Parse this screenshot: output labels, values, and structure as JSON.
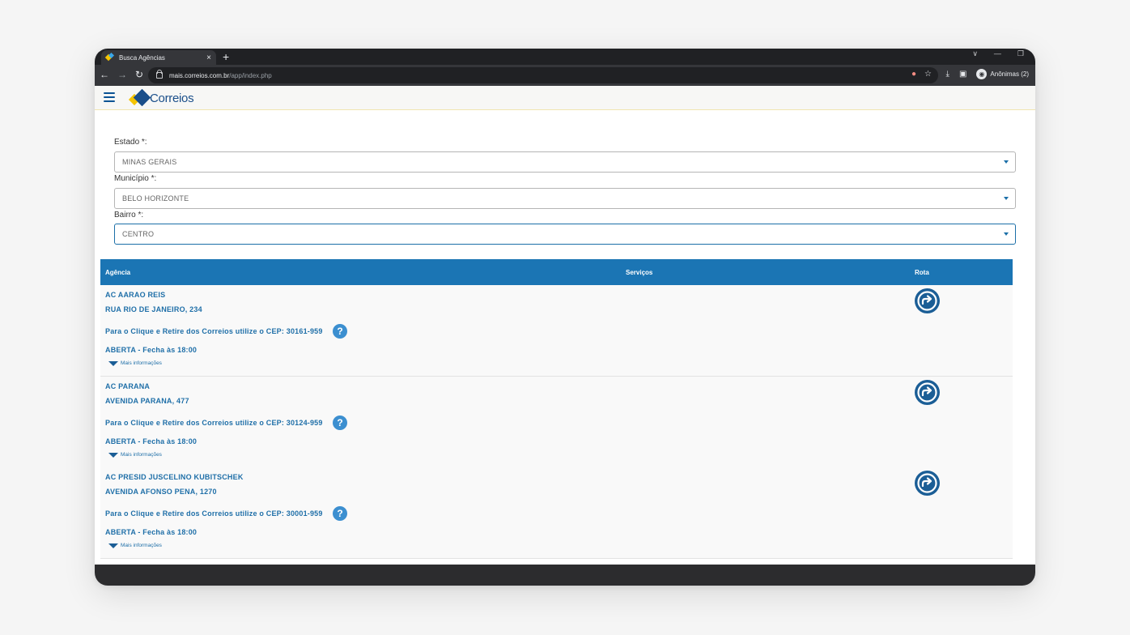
{
  "browser": {
    "tab_title": "Busca Agências",
    "tab_close": "×",
    "new_tab": "+",
    "url_host": "mais.correios.com.br",
    "url_path": "/app/index.php",
    "profile_label": "Anônimas (2)"
  },
  "site": {
    "logo_text": "Correios"
  },
  "form": {
    "estado_label": "Estado *:",
    "estado_value": "MINAS GERAIS",
    "municipio_label": "Município *:",
    "municipio_value": "BELO HORIZONTE",
    "bairro_label": "Bairro *:",
    "bairro_value": "CENTRO"
  },
  "table": {
    "headers": [
      "Agência",
      "Serviços",
      "Rota"
    ],
    "rows": [
      {
        "name": "AC AARAO REIS",
        "address": "RUA RIO DE JANEIRO, 234",
        "cep_text": "Para o Clique e Retire dos Correios utilize o CEP: 30161-959",
        "status": "ABERTA - Fecha às 18:00",
        "more": "Mais informações"
      },
      {
        "name": "AC PARANA",
        "address": "AVENIDA PARANA, 477",
        "cep_text": "Para o Clique e Retire dos Correios utilize o CEP: 30124-959",
        "status": "ABERTA - Fecha às 18:00",
        "more": "Mais informações"
      },
      {
        "name": "AC PRESID JUSCELINO KUBITSCHEK",
        "address": "AVENIDA AFONSO PENA, 1270",
        "cep_text": "Para o Clique e Retire dos Correios utilize o CEP: 30001-959",
        "status": "ABERTA - Fecha às 18:00",
        "more": "Mais informações"
      }
    ]
  },
  "icons": {
    "help": "?"
  },
  "colors": {
    "brand_blue": "#1b5e96",
    "header_blue": "#1b75b4",
    "brand_yellow": "#f5c400"
  }
}
